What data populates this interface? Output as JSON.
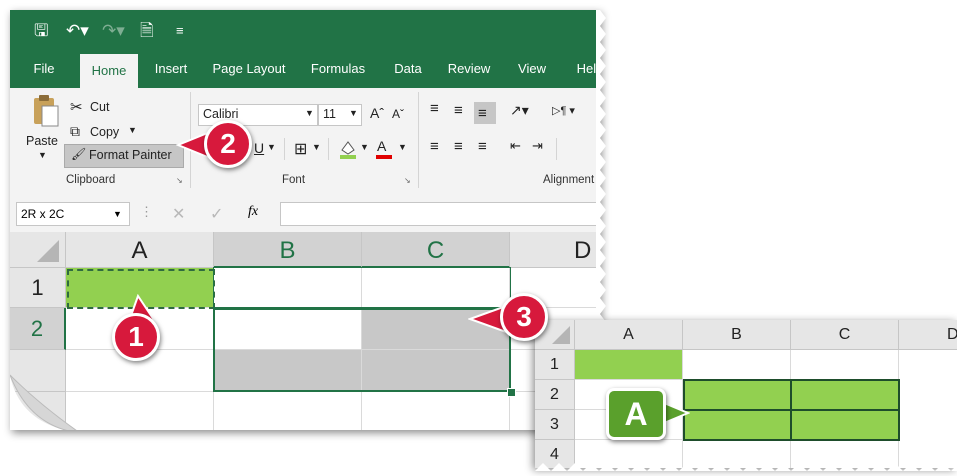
{
  "qat": {
    "save_icon": "save-icon",
    "undo_icon": "undo-icon",
    "redo_icon": "redo-icon",
    "new_icon": "new-doc-icon",
    "customize_icon": "customize-qat-icon"
  },
  "tabs": [
    "File",
    "Home",
    "Insert",
    "Page Layout",
    "Formulas",
    "Data",
    "Review",
    "View",
    "Help"
  ],
  "clipboard": {
    "paste": "Paste",
    "cut": "Cut",
    "copy": "Copy",
    "format_painter": "Format Painter",
    "group_label": "Clipboard"
  },
  "font": {
    "name": "Calibri",
    "size": "11",
    "group_label": "Font"
  },
  "alignment": {
    "group_label": "Alignment"
  },
  "formula_bar": {
    "name_box": "2R x 2C",
    "fx": "fx",
    "formula": ""
  },
  "sheet": {
    "columns": [
      "A",
      "B",
      "C",
      "D"
    ],
    "rows": [
      "1",
      "2"
    ]
  },
  "inset": {
    "columns": [
      "A",
      "B",
      "C",
      "D"
    ],
    "rows": [
      "1",
      "2",
      "3",
      "4"
    ]
  },
  "callouts": {
    "c1": "1",
    "c2": "2",
    "c3": "3",
    "cA": "A"
  },
  "colors": {
    "excel_green": "#217346",
    "cell_green": "#92d050",
    "cell_gray": "#c8c8c8",
    "callout_red": "#d7193c"
  }
}
